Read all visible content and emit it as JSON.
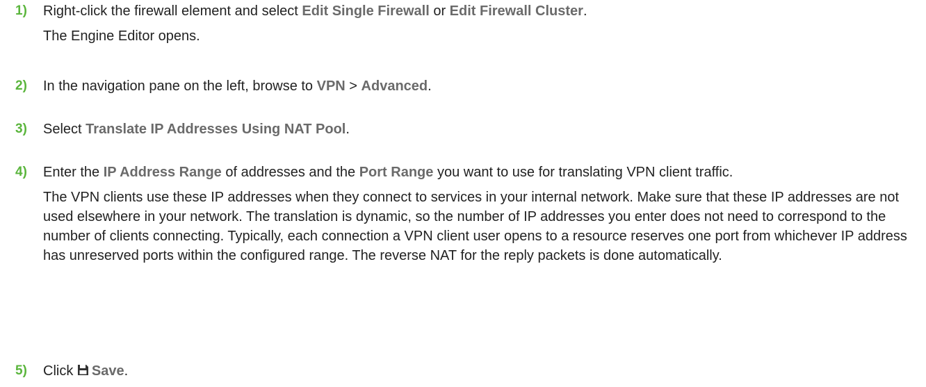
{
  "steps": [
    {
      "number": "1)",
      "parts": [
        "Right-click the firewall element and select ",
        "Edit Single Firewall",
        " or ",
        "Edit Firewall Cluster",
        "."
      ],
      "result": "The Engine Editor opens."
    },
    {
      "number": "2)",
      "parts": [
        "In the navigation pane on the left, browse to ",
        "VPN",
        " > ",
        "Advanced",
        "."
      ]
    },
    {
      "number": "3)",
      "parts": [
        "Select ",
        "Translate IP Addresses Using NAT Pool",
        "."
      ]
    },
    {
      "number": "4)",
      "parts": [
        "Enter the ",
        "IP Address Range",
        " of addresses and the ",
        "Port Range",
        " you want to use for translating VPN client traffic."
      ],
      "result": "The VPN clients use these IP addresses when they connect to services in your internal network. Make sure that these IP addresses are not used elsewhere in your network. The translation is dynamic, so the number of IP addresses you enter does not need to correspond to the number of clients connecting. Typically, each connection a VPN client user opens to a resource reserves one port from whichever IP address has unreserved ports within the configured range. The reverse NAT for the reply packets is done automatically."
    },
    {
      "number": "5)",
      "parts": [
        "Click ",
        "Save",
        "."
      ],
      "icon": "save-icon"
    }
  ],
  "colors": {
    "step_number": "#5ab53c",
    "ui_label": "#6a6a6a",
    "text": "#222222"
  }
}
